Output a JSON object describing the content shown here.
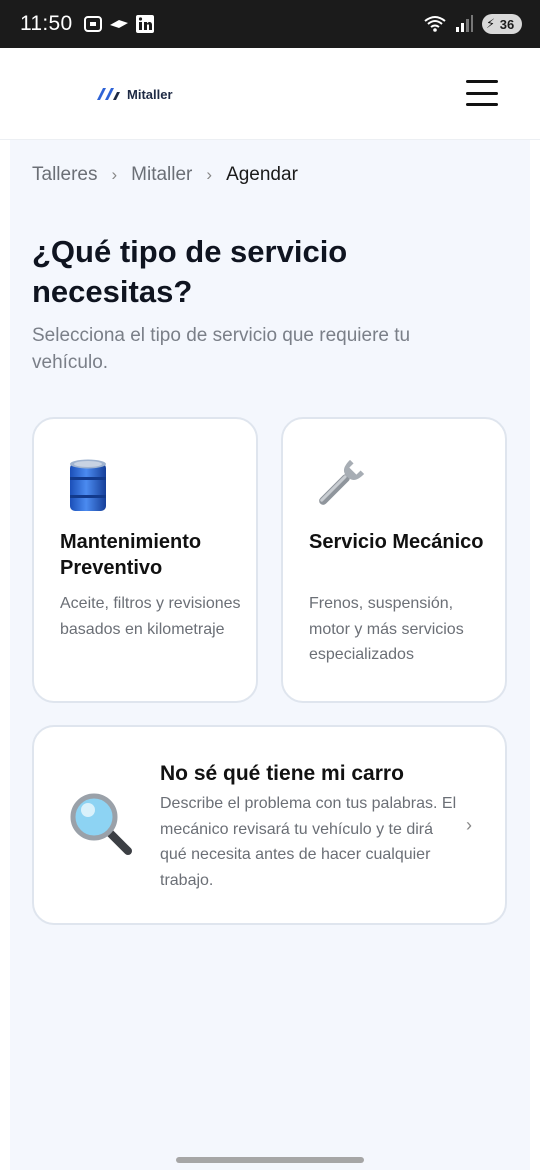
{
  "status_bar": {
    "time": "11:50",
    "battery": "36",
    "icons": [
      "screenshot-icon",
      "messenger-icon",
      "linkedin-icon",
      "wifi-icon",
      "signal-icon",
      "battery-icon"
    ]
  },
  "header": {
    "logo_text": "Mitaller",
    "brand_color": "#2f63d6"
  },
  "breadcrumb": {
    "items": [
      "Talleres",
      "Mitaller",
      "Agendar"
    ],
    "separator": "›"
  },
  "page": {
    "title": "¿Qué tipo de servicio necesitas?",
    "subtitle": "Selecciona el tipo de servicio que requiere tu vehículo."
  },
  "services": [
    {
      "icon": "oil-barrel-icon",
      "title": "Mantenimiento Preventivo",
      "description": "Aceite, filtros y revisiones basados en kilometraje"
    },
    {
      "icon": "wrench-icon",
      "title": "Servicio Mecánico",
      "description": "Frenos, suspensión, motor y más servicios especializados"
    }
  ],
  "diagnosis": {
    "icon": "magnifier-icon",
    "title": "No sé qué tiene mi carro",
    "description": "Describe el problema con tus palabras. El mecánico revisará tu vehículo y te dirá qué necesita antes de hacer cualquier trabajo.",
    "chevron": "›"
  },
  "colors": {
    "page_background": "#f4f7fd",
    "card_border": "#dfe5ee",
    "title": "#0f1420",
    "muted_text": "#6b6f76"
  }
}
